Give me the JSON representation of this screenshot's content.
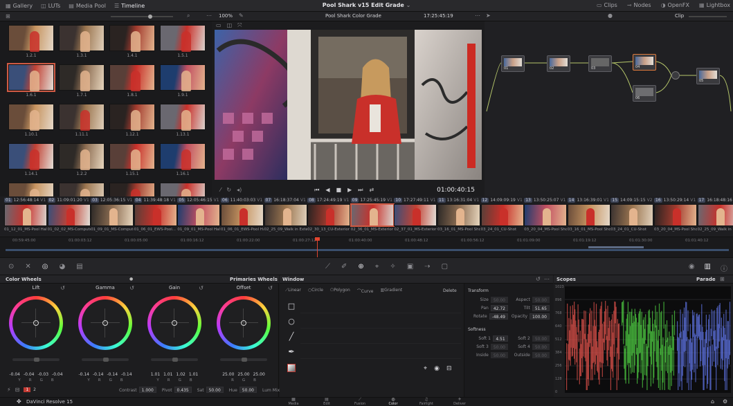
{
  "topbar": {
    "tabs": [
      {
        "label": "Gallery",
        "icon": "gallery-icon"
      },
      {
        "label": "LUTs",
        "icon": "lut-icon"
      },
      {
        "label": "Media Pool",
        "icon": "media-pool-icon"
      },
      {
        "label": "Timeline",
        "icon": "timeline-icon"
      }
    ],
    "title": "Pool Shark v15 Edit Grade",
    "right_tabs": [
      {
        "label": "Clips"
      },
      {
        "label": "Nodes"
      },
      {
        "label": "OpenFX"
      },
      {
        "label": "Lightbox"
      }
    ]
  },
  "toolbar2": {
    "zoom": "100%",
    "timeline_name": "Pool Shark Color Grade",
    "timecode": "17:25:45:19",
    "clip_mode": "Clip"
  },
  "gallery": {
    "stills": [
      "1.2.1",
      "1.3.1",
      "1.4.1",
      "1.5.1",
      "1.6.1",
      "1.7.1",
      "1.8.1",
      "1.9.1",
      "1.10.1",
      "1.11.1",
      "1.12.1",
      "1.13.1",
      "1.14.1",
      "1.2.2",
      "1.15.1",
      "1.16.1",
      "",
      "",
      "",
      ""
    ]
  },
  "viewer": {
    "timecode": "01:00:40:15"
  },
  "clips": [
    {
      "num": "01",
      "tc": "12:56:48:14",
      "track": "V1",
      "cap": "01_12_01_MS-Pool Hall"
    },
    {
      "num": "02",
      "tc": "11:09:01:20",
      "track": "V1",
      "cap": "01_02_02_MS-Computer"
    },
    {
      "num": "03",
      "tc": "12:05:36:15",
      "track": "V1",
      "cap": "01_09_01_MS-Computer"
    },
    {
      "num": "04",
      "tc": "11:39:48:18",
      "track": "V1",
      "cap": "01_06_01_EWS-Pool..."
    },
    {
      "num": "05",
      "tc": "12:05:46:15",
      "track": "V1",
      "cap": "01_09_01_MS-Pool Hall"
    },
    {
      "num": "06",
      "tc": "11:40:03:03",
      "track": "V1",
      "cap": "01_06_01_EWS-Pool Hall"
    },
    {
      "num": "07",
      "tc": "16:18:37:04",
      "track": "V1",
      "cap": "02_25_09_Walk in Exter..."
    },
    {
      "num": "08",
      "tc": "17:24:49:19",
      "track": "V1",
      "cap": "02_30_13_CU-Exterior"
    },
    {
      "num": "09",
      "tc": "17:25:45:19",
      "track": "V1",
      "cap": "02_36_01_MS-Exterior"
    },
    {
      "num": "10",
      "tc": "17:27:49:11",
      "track": "V1",
      "cap": "02_37_01_MS-Exterior"
    },
    {
      "num": "11",
      "tc": "13:16:31:04",
      "track": "V1",
      "cap": "03_16_01_MS-Pool Shot"
    },
    {
      "num": "12",
      "tc": "14:09:09:19",
      "track": "V1",
      "cap": "03_24_01_CU-Shot"
    },
    {
      "num": "13",
      "tc": "13:50:25:07",
      "track": "V1",
      "cap": "03_20_04_MS-Pool Shot"
    },
    {
      "num": "14",
      "tc": "13:16:39:01",
      "track": "V1",
      "cap": "03_16_01_MS-Pool Shot"
    },
    {
      "num": "15",
      "tc": "14:09:15:15",
      "track": "V2",
      "cap": "03_24_01_CU-Shot"
    },
    {
      "num": "16",
      "tc": "13:50:29:14",
      "track": "V1",
      "cap": "03_20_04_MS-Pool Shot"
    },
    {
      "num": "17",
      "tc": "16:18:48:16",
      "track": "V1",
      "cap": "02_25_09_Walk in"
    }
  ],
  "ruler": [
    "00:59:45:00",
    "01:00:03:12",
    "01:00:05:00",
    "01:00:16:12",
    "01:00:22:00",
    "01:00:27:12",
    "01:00:40:00",
    "01:00:48:12",
    "01:00:56:12",
    "01:01:09:00",
    "01:01:19:12",
    "01:01:30:00",
    "01:01:40:12",
    "01:01:57:00"
  ],
  "nodes": [
    "01",
    "02",
    "03",
    "04",
    "05",
    "06"
  ],
  "color_wheels": {
    "title": "Color Wheels",
    "mode": "Primaries Wheels",
    "wheels": [
      {
        "name": "Lift",
        "values": [
          "-0.04",
          "-0.04",
          "-0.03",
          "-0.04"
        ]
      },
      {
        "name": "Gamma",
        "values": [
          "-0.14",
          "-0.14",
          "-0.14",
          "-0.14"
        ]
      },
      {
        "name": "Gain",
        "values": [
          "1.01",
          "1.01",
          "1.02",
          "1.01"
        ]
      },
      {
        "name": "Offset",
        "values": [
          "25.00",
          "25.00",
          "25.00"
        ]
      }
    ],
    "value_letters_4": [
      "Y",
      "R",
      "G",
      "B"
    ],
    "value_letters_3": [
      "R",
      "G",
      "B"
    ],
    "pages": [
      "1",
      "2"
    ],
    "bottom": [
      {
        "label": "Contrast",
        "value": "1.000"
      },
      {
        "label": "Pivot",
        "value": "0.435"
      },
      {
        "label": "Sat",
        "value": "50.00"
      },
      {
        "label": "Hue",
        "value": "50.00"
      },
      {
        "label": "Lum Mix",
        "value": "100.00"
      }
    ]
  },
  "window": {
    "title": "Window",
    "tools": [
      "Linear",
      "Circle",
      "Polygon",
      "Curve",
      "Gradient"
    ],
    "delete": "Delete",
    "transform_title": "Transform",
    "transform": [
      {
        "label": "Size",
        "value": "50.00",
        "dim": true
      },
      {
        "label": "Aspect",
        "value": "50.00",
        "dim": true
      },
      {
        "label": "Pan",
        "value": "42.72",
        "dim": false
      },
      {
        "label": "Tilt",
        "value": "51.65",
        "dim": false
      },
      {
        "label": "Rotate",
        "value": "-48.49",
        "dim": false
      },
      {
        "label": "Opacity",
        "value": "100.00",
        "dim": false
      }
    ],
    "softness_title": "Softness",
    "softness": [
      {
        "label": "Soft 1",
        "value": "4.51",
        "dim": false
      },
      {
        "label": "Soft 2",
        "value": "50.00",
        "dim": true
      },
      {
        "label": "Soft 3",
        "value": "50.00",
        "dim": true
      },
      {
        "label": "Soft 4",
        "value": "50.00",
        "dim": true
      },
      {
        "label": "Inside",
        "value": "50.00",
        "dim": true
      },
      {
        "label": "Outside",
        "value": "50.00",
        "dim": true
      }
    ]
  },
  "scopes": {
    "title": "Scopes",
    "mode": "Parade",
    "scale": [
      "1023",
      "896",
      "768",
      "640",
      "512",
      "384",
      "256",
      "128",
      "0"
    ]
  },
  "bottombar": {
    "app": "DaVinci Resolve 15",
    "pages": [
      "Media",
      "Edit",
      "Fusion",
      "Color",
      "Fairlight",
      "Deliver"
    ]
  }
}
